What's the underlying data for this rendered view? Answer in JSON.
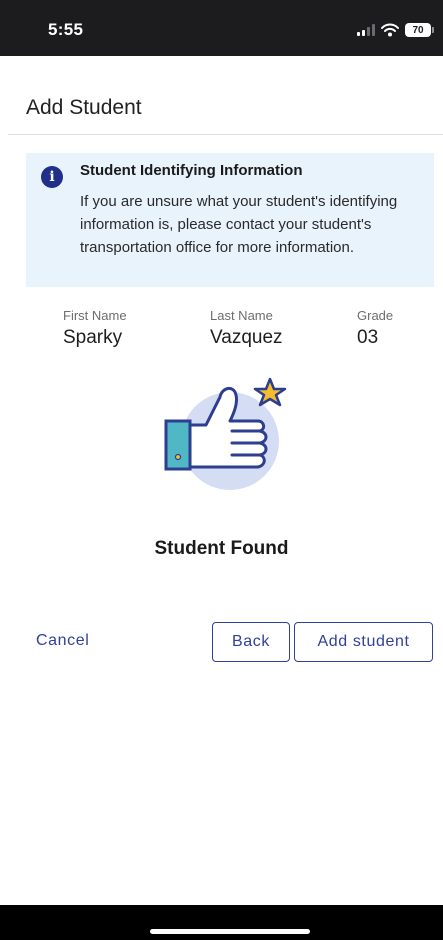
{
  "status_bar": {
    "time": "5:55",
    "battery": "70",
    "icons": [
      "signal-icon",
      "wifi-icon",
      "battery-icon"
    ]
  },
  "header": {
    "title": "Add Student"
  },
  "info": {
    "icon": "info-icon",
    "title": "Student Identifying Information",
    "body": "If you are unsure what your student's identifying information is, please contact your student's transportation office for more information."
  },
  "student": {
    "first_name_label": "First Name",
    "first_name": "Sparky",
    "last_name_label": "Last Name",
    "last_name": "Vazquez",
    "grade_label": "Grade",
    "grade": "03"
  },
  "result": {
    "icon": "thumbs-up-star-icon",
    "title": "Student Found"
  },
  "actions": {
    "cancel": "Cancel",
    "back": "Back",
    "add": "Add student"
  },
  "colors": {
    "accent": "#30419a",
    "info_background": "#e9f3fc",
    "status_bar": "#1c1c1e"
  }
}
